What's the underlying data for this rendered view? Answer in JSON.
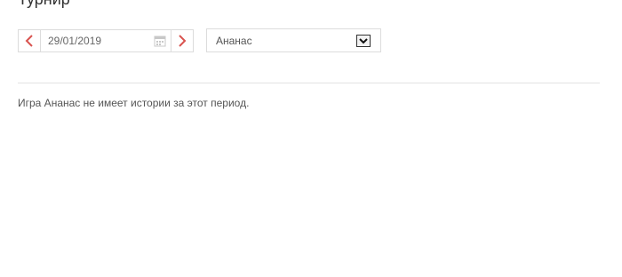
{
  "page": {
    "title": "Турнир"
  },
  "filters": {
    "date": "29/01/2019",
    "game_selected": "Ананас"
  },
  "message": "Игра Ананас не имеет истории за этот период.",
  "colors": {
    "accent_arrow": "#d9534f",
    "border": "#dcdcdc",
    "text": "#555555"
  },
  "icons": {
    "prev": "chevron-left-icon",
    "next": "chevron-right-icon",
    "calendar": "calendar-icon",
    "dropdown": "dropdown-arrow-icon"
  }
}
